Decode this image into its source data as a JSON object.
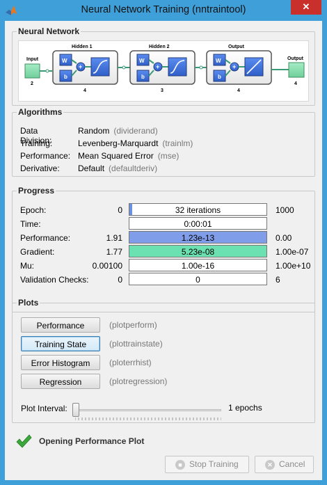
{
  "window": {
    "title": "Neural Network Training (nntraintool)",
    "close_glyph": "✕"
  },
  "network": {
    "section_title": "Neural Network",
    "input": {
      "label": "Input",
      "size": "2"
    },
    "layers": [
      {
        "title": "Hidden 1",
        "size": "4",
        "transfer": "sigmoid"
      },
      {
        "title": "Hidden 2",
        "size": "3",
        "transfer": "sigmoid"
      },
      {
        "title": "Output",
        "size": "4",
        "transfer": "linear"
      }
    ],
    "output": {
      "label": "Output",
      "size": "4"
    },
    "weight_label": "W",
    "bias_label": "b",
    "sum_glyph": "+",
    "colors": {
      "node_fill": "#8fe0b4",
      "node_border": "#3f8f60",
      "weight_fill": "#3c6ed6",
      "connector": "#3b9a76"
    }
  },
  "algorithms": {
    "section_title": "Algorithms",
    "rows": [
      {
        "key": "Data Division:",
        "value": "Random",
        "code": "(dividerand)"
      },
      {
        "key": "Training:",
        "value": "Levenberg-Marquardt",
        "code": "(trainlm)"
      },
      {
        "key": "Performance:",
        "value": "Mean Squared Error",
        "code": "(mse)"
      },
      {
        "key": "Derivative:",
        "value": "Default",
        "code": "(defaultderiv)"
      }
    ]
  },
  "progress": {
    "section_title": "Progress",
    "rows": [
      {
        "label": "Epoch:",
        "min": "0",
        "text": "32 iterations",
        "max": "1000",
        "fill_fraction": 0.02,
        "fill_color": "#6d8fe0"
      },
      {
        "label": "Time:",
        "min": "",
        "text": "0:00:01",
        "max": "",
        "fill_fraction": 0,
        "fill_color": "#ffffff"
      },
      {
        "label": "Performance:",
        "min": "1.91",
        "text": "1.23e-13",
        "max": "0.00",
        "fill_fraction": 1.0,
        "fill_color": "#7f9de8"
      },
      {
        "label": "Gradient:",
        "min": "1.77",
        "text": "5.23e-08",
        "max": "1.00e-07",
        "fill_fraction": 1.0,
        "fill_color": "#6be0b0"
      },
      {
        "label": "Mu:",
        "min": "0.00100",
        "text": "1.00e-16",
        "max": "1.00e+10",
        "fill_fraction": 0,
        "fill_color": "#ffffff"
      },
      {
        "label": "Validation Checks:",
        "min": "0",
        "text": "0",
        "max": "6",
        "fill_fraction": 0,
        "fill_color": "#ffffff"
      }
    ]
  },
  "plots": {
    "section_title": "Plots",
    "buttons": [
      {
        "label": "Performance",
        "fn": "(plotperform)"
      },
      {
        "label": "Training State",
        "fn": "(plottrainstate)"
      },
      {
        "label": "Error Histogram",
        "fn": "(ploterrhist)"
      },
      {
        "label": "Regression",
        "fn": "(plotregression)"
      }
    ],
    "interval_label": "Plot Interval:",
    "interval_value": "1 epochs",
    "slider_fraction": 0
  },
  "status": {
    "text": "Opening Performance Plot",
    "icon": "check-icon"
  },
  "footer": {
    "stop_label": "Stop Training",
    "stop_icon": "stop-icon",
    "cancel_label": "Cancel",
    "cancel_icon": "cancel-x-icon"
  }
}
